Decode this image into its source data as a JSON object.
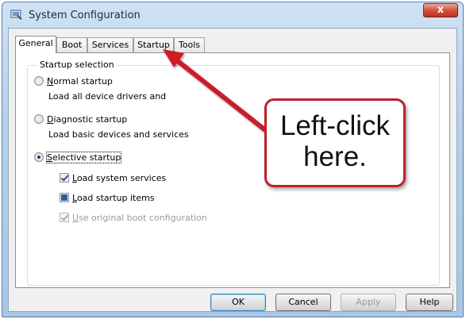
{
  "window": {
    "title": "System Configuration",
    "close_label": "x"
  },
  "tabs": [
    "General",
    "Boot",
    "Services",
    "Startup",
    "Tools"
  ],
  "selected_tab": "General",
  "startup_selection": {
    "group_title": "Startup selection",
    "normal": {
      "label": "Normal startup",
      "mnemonic": "N",
      "rest": "ormal startup",
      "description": "Load all device drivers and"
    },
    "diagnostic": {
      "label": "Diagnostic startup",
      "mnemonic": "D",
      "rest": "iagnostic startup",
      "description": "Load basic devices and services"
    },
    "selective": {
      "label": "Selective startup",
      "mnemonic": "S",
      "rest": "elective startup",
      "selected": true
    },
    "options": {
      "load_system_services": {
        "mnemonic": "L",
        "rest": "oad system services",
        "state": "checked"
      },
      "load_startup_items": {
        "mnemonic": "L",
        "rest": "oad startup items",
        "state": "indeterminate"
      },
      "use_original_boot": {
        "mnemonic": "U",
        "rest": "se original boot configuration",
        "state": "checked-disabled"
      }
    }
  },
  "buttons": {
    "ok": "OK",
    "cancel": "Cancel",
    "apply": "Apply",
    "help": "Help"
  },
  "annotation": {
    "callout_text_line1": "Left-click",
    "callout_text_line2": "here.",
    "color": "#c0202a"
  },
  "colors": {
    "title_bar": "#b9d1ea",
    "close_button": "#c1311d",
    "ok_focus": "#3c7fb1"
  }
}
